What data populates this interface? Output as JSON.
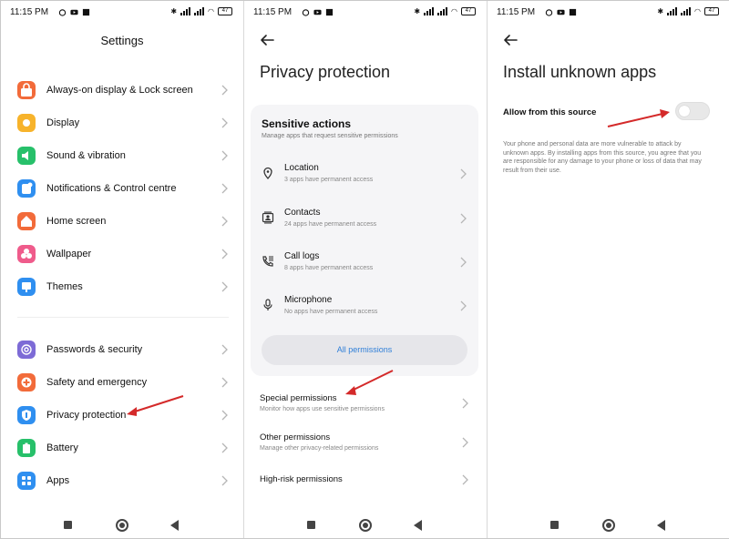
{
  "status": {
    "time": "11:15 PM",
    "battery": "47"
  },
  "settings": {
    "title": "Settings",
    "items": [
      {
        "label": "Always-on display & Lock screen",
        "icon": "lock-screen-icon",
        "color": "#f26b3a"
      },
      {
        "label": "Display",
        "icon": "sun-icon",
        "color": "#f7b32b"
      },
      {
        "label": "Sound & vibration",
        "icon": "speaker-icon",
        "color": "#27c06a"
      },
      {
        "label": "Notifications & Control centre",
        "icon": "notification-icon",
        "color": "#2f8ff0"
      },
      {
        "label": "Home screen",
        "icon": "home-icon",
        "color": "#f26b3a"
      },
      {
        "label": "Wallpaper",
        "icon": "flower-icon",
        "color": "#ef5b8b"
      },
      {
        "label": "Themes",
        "icon": "themes-icon",
        "color": "#2f8ff0"
      },
      {
        "label": "Passwords & security",
        "icon": "fingerprint-icon",
        "color": "#7d6bd6"
      },
      {
        "label": "Safety and emergency",
        "icon": "emergency-icon",
        "color": "#f26b3a"
      },
      {
        "label": "Privacy protection",
        "icon": "privacy-icon",
        "color": "#2f8ff0"
      },
      {
        "label": "Battery",
        "icon": "battery-icon",
        "color": "#27c06a"
      },
      {
        "label": "Apps",
        "icon": "apps-icon",
        "color": "#2f8ff0"
      }
    ]
  },
  "privacy": {
    "title": "Privacy protection",
    "card_title": "Sensitive actions",
    "card_subtitle": "Manage apps that request sensitive permissions",
    "permissions": [
      {
        "title": "Location",
        "subtitle": "3 apps have permanent access",
        "icon": "location-icon"
      },
      {
        "title": "Contacts",
        "subtitle": "24 apps have permanent access",
        "icon": "contacts-icon"
      },
      {
        "title": "Call logs",
        "subtitle": "8 apps have permanent access",
        "icon": "call-log-icon"
      },
      {
        "title": "Microphone",
        "subtitle": "No apps have permanent access",
        "icon": "microphone-icon"
      }
    ],
    "all_permissions": "All permissions",
    "rows": [
      {
        "title": "Special permissions",
        "subtitle": "Monitor how apps use sensitive permissions"
      },
      {
        "title": "Other permissions",
        "subtitle": "Manage other privacy-related permissions"
      },
      {
        "title": "High-risk permissions",
        "subtitle": ""
      }
    ]
  },
  "install": {
    "title": "Install unknown apps",
    "allow_label": "Allow from this source",
    "toggle_on": false,
    "warning": "Your phone and personal data are more vulnerable to attack by unknown apps. By installing apps from this source, you agree that you are responsible for any damage to your phone or loss of data that may result from their use."
  },
  "colors": {
    "annotation_arrow": "#d42a2a",
    "link_blue": "#2f7fd8"
  }
}
